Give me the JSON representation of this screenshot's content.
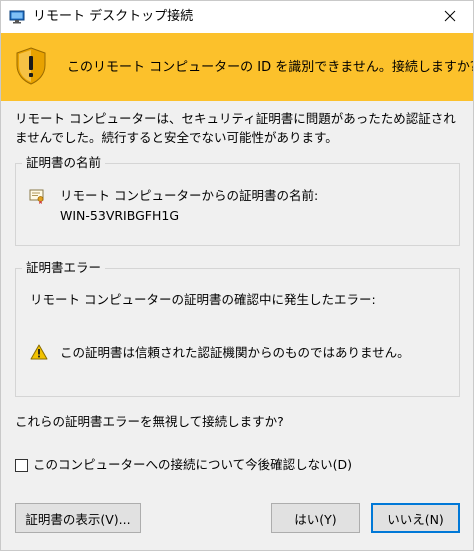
{
  "window": {
    "title": "リモート デスクトップ接続",
    "app_icon": "remote-desktop-icon",
    "close_icon": "close-icon"
  },
  "banner": {
    "icon": "shield-warning-icon",
    "text": "このリモート コンピューターの ID を識別できません。接続しますか?",
    "color": "#fcc12b"
  },
  "intro": {
    "text": "リモート コンピューターは、セキュリティ証明書に問題があったため認証されませんでした。続行すると安全でない可能性があります。"
  },
  "cert_name_group": {
    "legend": "証明書の名前",
    "icon": "certificate-icon",
    "label": "リモート コンピューターからの証明書の名前:",
    "value": "WIN-53VRIBGFH1G"
  },
  "cert_error_group": {
    "legend": "証明書エラー",
    "label": "リモート コンピューターの証明書の確認中に発生したエラー:",
    "icon": "warning-icon",
    "item": "この証明書は信頼された認証機関からのものではありません。"
  },
  "question": {
    "text": "これらの証明書エラーを無視して接続しますか?"
  },
  "checkbox": {
    "label": "このコンピューターへの接続について今後確認しない(D)",
    "checked": false
  },
  "buttons": {
    "view_cert": "証明書の表示(V)...",
    "yes": "はい(Y)",
    "no": "いいえ(N)"
  },
  "colors": {
    "accent": "#0078d7",
    "warning": "#fcc12b"
  }
}
